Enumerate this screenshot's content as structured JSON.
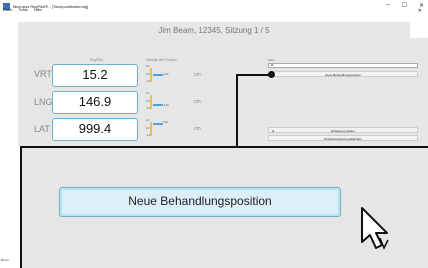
{
  "window": {
    "title": "Micropos RayPilot® - [Tischpositionierung]",
    "controls": [
      "–",
      "☐",
      "✕"
    ]
  },
  "menu": {
    "items": [
      "Datei",
      "Tools",
      "Hilfe"
    ]
  },
  "header": {
    "patient": "Jim Beam, 12345, Sitzung 1 / 5"
  },
  "columns": {
    "raypilot": "RayPilot",
    "deviation": "Abfolge der Position"
  },
  "rows": [
    {
      "label": "VRT",
      "value": "15.2",
      "unit": "cm",
      "gauge_top": "0.1",
      "gauge_mid": "0.0",
      "gauge_bot": "-0.1",
      "gauge_val": "-0.01"
    },
    {
      "label": "LNG",
      "value": "146.9",
      "unit": "cm",
      "gauge_top": "0.1",
      "gauge_mid": "0.0",
      "gauge_bot": "-0.1",
      "gauge_val": "-0.00"
    },
    {
      "label": "LAT",
      "value": "999.4",
      "unit": "cm",
      "gauge_top": "0.1",
      "gauge_mid": "0.0",
      "gauge_bot": "-0.1",
      "gauge_val": "0.00"
    }
  ],
  "right": {
    "field_label": "Feld",
    "field_value": "Ri",
    "new_position_label": "Neue Behandlungsposition",
    "start_label": "Erfassung starten",
    "end_label": "Positionsverlauf ausblenden"
  },
  "zoom": {
    "button_label": "Neue Behandlungsposition"
  },
  "status": {
    "text": "Bereit"
  },
  "colors": {
    "accent": "#6fb1c9",
    "panel": "#e6e6e6",
    "gauge": "#f0c040",
    "indicator": "#4aa3df"
  }
}
